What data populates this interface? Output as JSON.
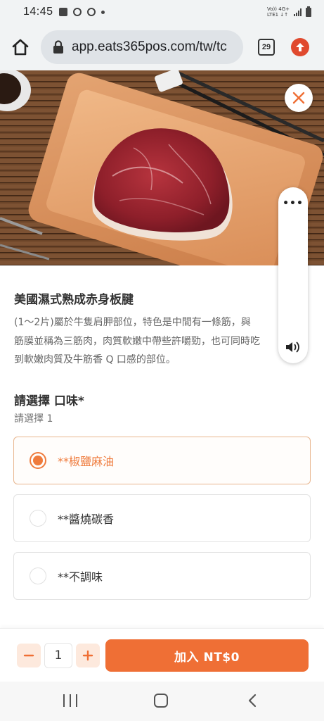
{
  "status_bar": {
    "time": "14:45",
    "network_top": "Vo)) 4G+",
    "network_bottom": "LTE1 ↓↑"
  },
  "browser": {
    "url": "app.eats365pos.com/tw/tc",
    "tab_count": "29"
  },
  "product": {
    "name": "美國濕式熟成赤身板腱",
    "description_lines": [
      "(1～2片)屬於牛隻肩胛部位，特色是中間有一條筋，與",
      "筋膜並稱為三筋肉，肉質軟嫩中帶些許嚼勁，也可同時吃",
      "到軟嫩肉質及牛筋香 Q 口感的部位。"
    ]
  },
  "options_group": {
    "title": "請選擇 口味*",
    "subtitle": "請選擇 1",
    "options": [
      {
        "label": "**椒鹽麻油",
        "selected": true
      },
      {
        "label": "**醬燒碳香",
        "selected": false
      },
      {
        "label": "**不調味",
        "selected": false
      }
    ]
  },
  "quantity": {
    "value": "1",
    "minus_label": "−",
    "plus_label": "+"
  },
  "add_button": {
    "label": "加入 NT$0"
  },
  "side_panel": {
    "menu_label": "•••"
  },
  "colors": {
    "accent": "#ef6f35",
    "accent_light": "#fde9dd",
    "selected_border": "#e8b58e"
  }
}
